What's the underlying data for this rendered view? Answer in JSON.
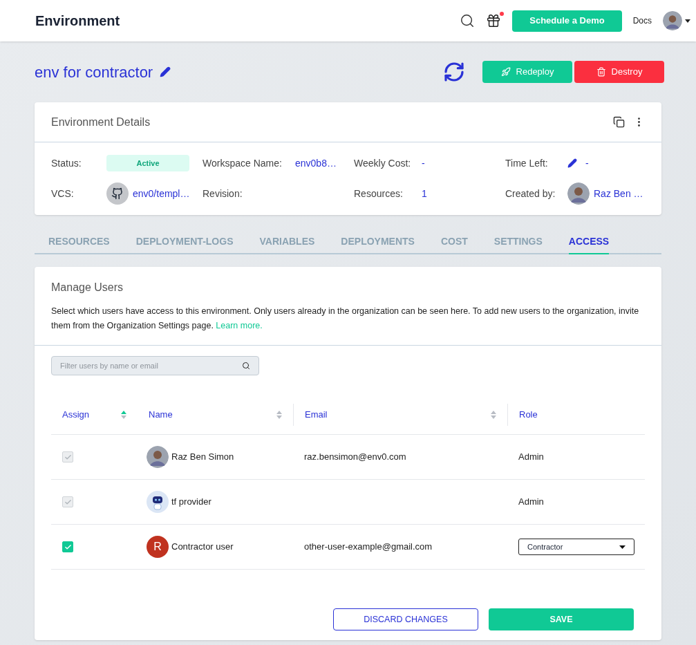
{
  "header": {
    "title": "Environment",
    "notification": true,
    "demo_button": "Schedule a Demo",
    "docs_link": "Docs"
  },
  "environment": {
    "name": "env for contractor",
    "actions": [
      {
        "kind": "redeploy",
        "label": "Redeploy"
      },
      {
        "kind": "destroy",
        "label": "Destroy"
      }
    ]
  },
  "details": {
    "title": "Environment Details",
    "fields": [
      {
        "label": "Status:",
        "value": "Active",
        "kind": "badge"
      },
      {
        "label": "Workspace Name:",
        "value": "env0b8…",
        "kind": "link"
      },
      {
        "label": "Weekly Cost:",
        "value": "-",
        "kind": "link"
      },
      {
        "label": "Time Left:",
        "value": "-",
        "kind": "editable"
      },
      {
        "label": "VCS:",
        "value": "env0/templ…",
        "kind": "vcs"
      },
      {
        "label": "Revision:",
        "kind": "text"
      },
      {
        "label": "Resources:",
        "value": "1",
        "kind": "link"
      },
      {
        "label": "Created by:",
        "value": "Raz Ben …",
        "kind": "user"
      }
    ]
  },
  "tabs": [
    {
      "label": "RESOURCES",
      "selected": false
    },
    {
      "label": "DEPLOYMENT-LOGS",
      "selected": false
    },
    {
      "label": "VARIABLES",
      "selected": false
    },
    {
      "label": "DEPLOYMENTS",
      "selected": false
    },
    {
      "label": "COST",
      "selected": false
    },
    {
      "label": "SETTINGS",
      "selected": false
    },
    {
      "label": "ACCESS",
      "selected": true
    }
  ],
  "manage_users": {
    "title": "Manage Users",
    "description": "Select which users have access to this environment. Only users already in the organization can be seen here. To add new users to the organization, invite them from the Organization Settings page.",
    "learn_more": "Learn more.",
    "filter": {
      "placeholder": "Filter users by name or email"
    },
    "columns": [
      {
        "label": "Assign",
        "kind": "sorted"
      },
      {
        "label": "Name",
        "kind": "sortable"
      },
      {
        "label": "Email",
        "kind": "sortable"
      },
      {
        "label": "Role",
        "kind": "plain"
      }
    ],
    "rows": [
      {
        "checked": true,
        "disabled": true,
        "avatar": {
          "kind": "photo"
        },
        "name": "Raz Ben Simon",
        "email": "raz.bensimon@env0.com",
        "role": {
          "kind": "text",
          "value": "Admin"
        }
      },
      {
        "checked": true,
        "disabled": true,
        "avatar": {
          "kind": "robot"
        },
        "name": "tf provider",
        "role": {
          "kind": "text",
          "value": "Admin"
        }
      },
      {
        "checked": true,
        "disabled": false,
        "avatar": {
          "kind": "letter",
          "initial": "R"
        },
        "name": "Contractor user",
        "email": "other-user-example@gmail.com",
        "role": {
          "kind": "select",
          "value": "Contractor"
        }
      }
    ],
    "buttons": {
      "discard": "DISCARD CHANGES",
      "save": "SAVE"
    }
  }
}
